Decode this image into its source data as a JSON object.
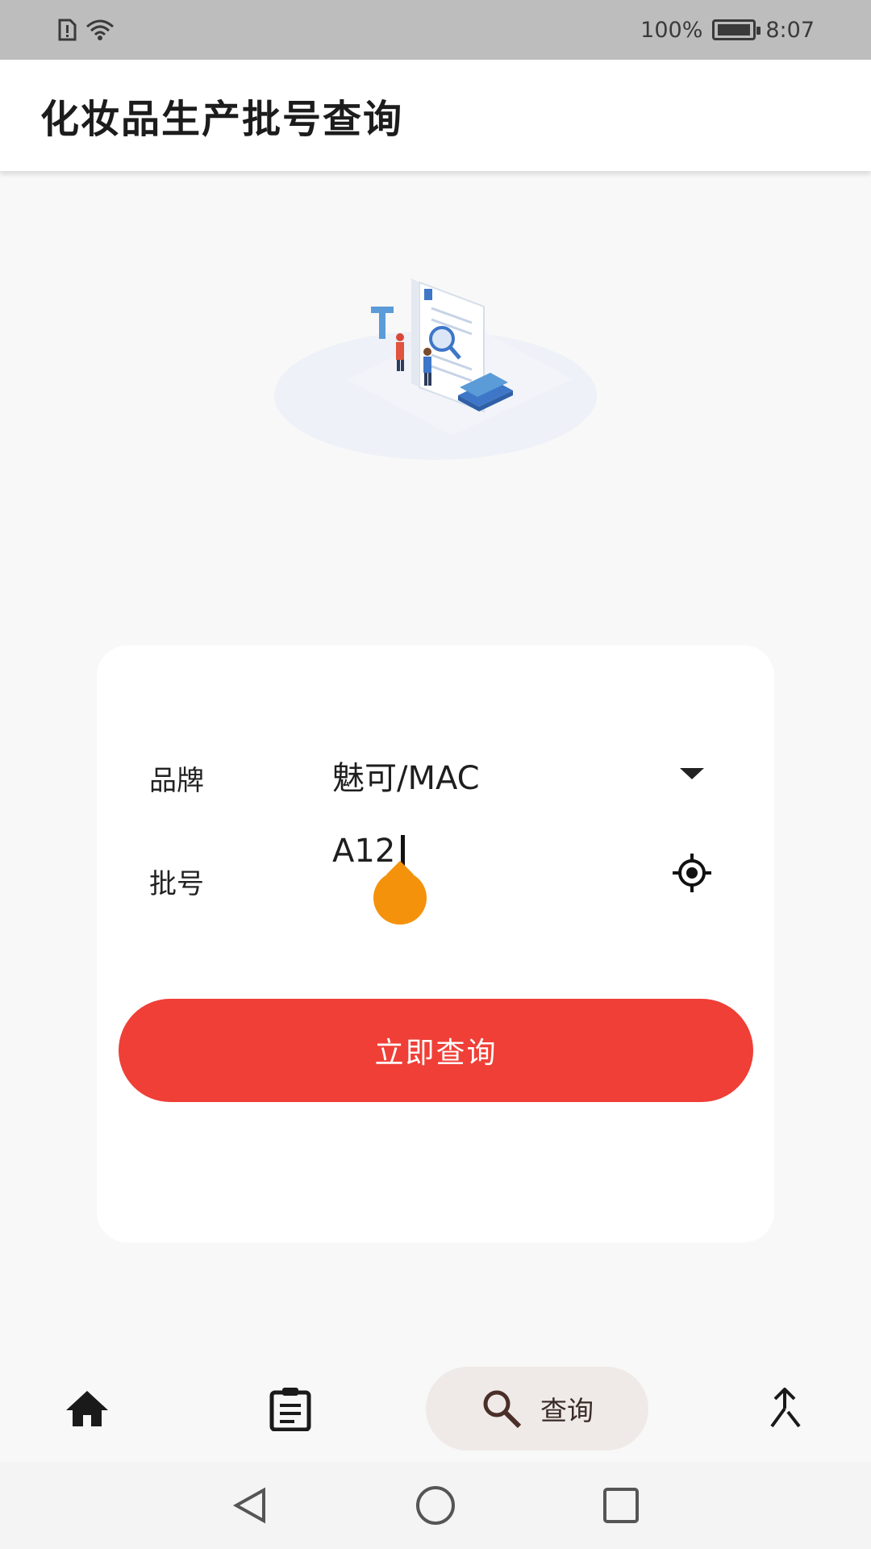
{
  "status_bar": {
    "battery_percent": "100%",
    "time": "8:07",
    "icons": [
      "sim-alert-icon",
      "wifi-icon",
      "battery-icon"
    ]
  },
  "app_bar": {
    "title": "化妆品生产批号查询"
  },
  "form": {
    "brand_label": "品牌",
    "brand_value": "魅可/MAC",
    "batch_label": "批号",
    "batch_value": "A12",
    "submit_label": "立即查询"
  },
  "bottom_nav": {
    "items": [
      {
        "icon": "home-icon",
        "label": ""
      },
      {
        "icon": "clipboard-icon",
        "label": ""
      },
      {
        "icon": "search-icon",
        "label": "查询",
        "selected": true
      },
      {
        "icon": "merge-icon",
        "label": ""
      }
    ]
  },
  "colors": {
    "accent": "#ef3f37",
    "cursor_handle": "#f5920b",
    "nav_selected_bg": "#efeae8"
  }
}
